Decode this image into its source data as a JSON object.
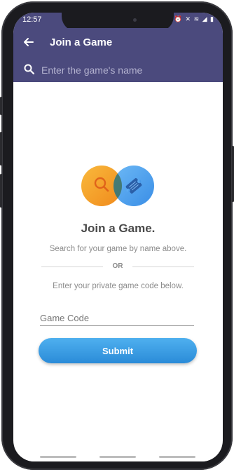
{
  "status_bar": {
    "time": "12:57",
    "icons": [
      "alarm-icon",
      "mute-icon",
      "wifi-icon",
      "signal-icon",
      "battery-icon"
    ],
    "icons_text": "⏰ ✕ ≋ ◢ ▮"
  },
  "app_bar": {
    "title": "Join a Game",
    "back_icon": "arrow-left-icon",
    "color": "#4b4a7d"
  },
  "search": {
    "placeholder": "Enter the game's name",
    "icon": "search-icon"
  },
  "main": {
    "illustration_icons": [
      "magnifier-icon",
      "ticket-icon"
    ],
    "headline": "Join a Game.",
    "search_hint": "Search for your game by name above.",
    "divider_label": "OR",
    "code_hint": "Enter your private game code below.",
    "code_placeholder": "Game Code",
    "submit_label": "Submit"
  },
  "colors": {
    "accent_blue": "#2f90dc",
    "accent_orange": "#f4a127",
    "header": "#4b4a7d"
  }
}
